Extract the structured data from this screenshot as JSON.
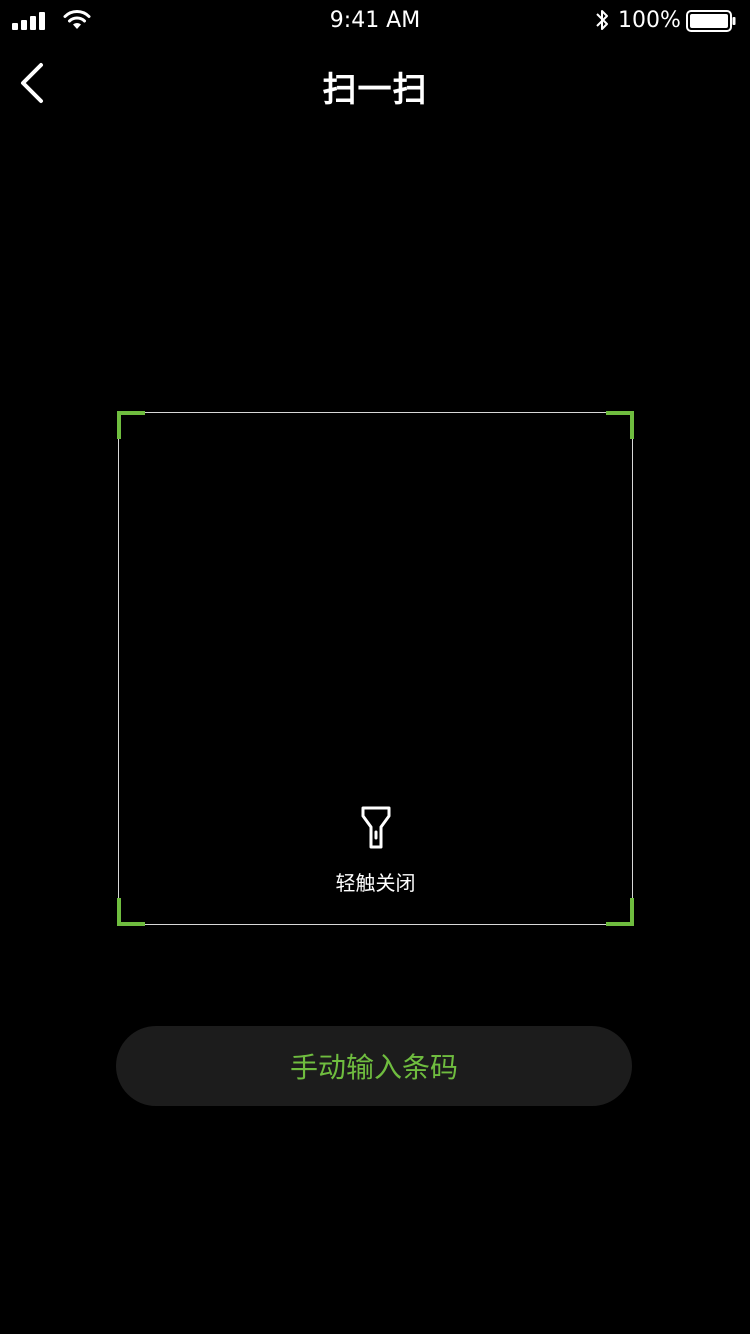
{
  "status_bar": {
    "time": "9:41 AM",
    "battery_percent": "100%",
    "icons": [
      "signal-icon",
      "wifi-icon",
      "bluetooth-icon",
      "battery-icon"
    ]
  },
  "nav": {
    "title": "扫一扫",
    "back_icon": "chevron-left-icon"
  },
  "scanner": {
    "flash_icon": "flashlight-icon",
    "flash_label": "轻触关闭",
    "corner_color": "#6fbd3f",
    "frame_border_color": "#d8d8d8"
  },
  "manual_entry": {
    "label": "手动输入条码",
    "text_color": "#6fbd3f",
    "background": "#1c1c1c"
  }
}
